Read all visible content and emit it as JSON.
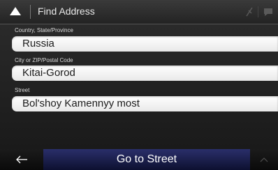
{
  "header": {
    "title": "Find Address",
    "up_icon": "caret-up-icon",
    "status_icons": [
      "gps-signal-icon",
      "messages-icon"
    ]
  },
  "fields": [
    {
      "label": "Country, State/Province",
      "value": "Russia"
    },
    {
      "label": "City or ZIP/Postal Code",
      "value": "Kitai-Gorod"
    },
    {
      "label": "Street",
      "value": "Bol'shoy Kamennyy most"
    }
  ],
  "bottom_bar": {
    "back_icon": "back-arrow-icon",
    "primary_label": "Go to Street",
    "more_icon": "chevron-up-icon"
  },
  "colors": {
    "primary_button": "#1f2459",
    "header": "#2e2e2e",
    "field_background": "#ffffff"
  }
}
